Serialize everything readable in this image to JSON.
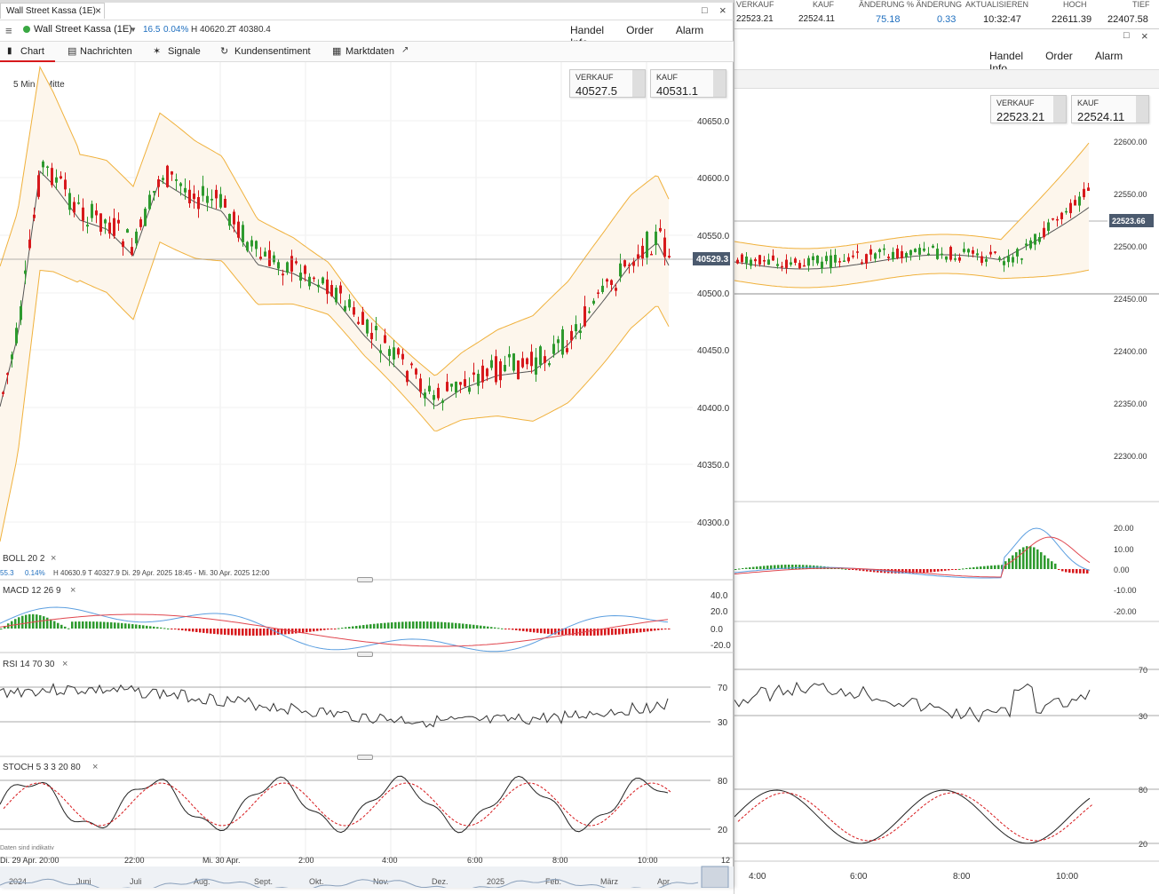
{
  "top_ticker": {
    "headers": [
      "VERKAUF",
      "KAUF",
      "ÄNDERUNG",
      "% ÄNDERUNG",
      "AKTUALISIEREN",
      "HOCH",
      "TIEF"
    ],
    "values": [
      "22523.21",
      "22524.11",
      "75.18",
      "0.33",
      "10:32:47",
      "22611.39",
      "22407.58"
    ]
  },
  "left_window": {
    "tab_title": "Wall Street Kassa (1E)",
    "instrument": "Wall Street Kassa (1E)",
    "change": "16.5",
    "change_pct": "0.04%",
    "high": "H 40620.2",
    "low": "T 40380.4",
    "menu": [
      "Handel",
      "Order",
      "Alarm",
      "Info"
    ],
    "tabs": [
      "Chart",
      "Nachrichten",
      "Signale",
      "Kundensentiment",
      "Marktdaten"
    ],
    "interval": "5 Min",
    "price_mode": "Mitte",
    "sell_label": "VERKAUF",
    "sell_value": "40527.5",
    "buy_label": "KAUF",
    "buy_value": "40531.1",
    "current_price_tag": "40529.3",
    "y_axis": [
      "40650.0",
      "40600.0",
      "40550.0",
      "40500.0",
      "40450.0",
      "40400.0",
      "40350.0",
      "40300.0"
    ],
    "boll_label": "BOLL  20  2",
    "boll_info_a": "55.3",
    "boll_info_b": "0.14%",
    "boll_info_c": "H 40630.9   T 40327.9   Di. 29 Apr. 2025 18:45 - Mi. 30 Apr. 2025 12:00",
    "macd_label": "MACD  12  26  9",
    "macd_axis": [
      "40.0",
      "20.0",
      "0.0",
      "-20.0"
    ],
    "rsi_label": "RSI  14  70  30",
    "rsi_axis": [
      "70",
      "30"
    ],
    "stoch_label": "STOCH  5  3  3  20  80",
    "stoch_axis": [
      "80",
      "20"
    ],
    "disclaimer": "Daten sind indikativ",
    "x_axis": [
      "Di. 29 Apr.  20:00",
      "22:00",
      "Mi. 30 Apr.",
      "2:00",
      "4:00",
      "6:00",
      "8:00",
      "10:00",
      "12"
    ],
    "nav_axis": [
      "2024",
      "Juni",
      "Juli",
      "Aug.",
      "Sept.",
      "Okt.",
      "Nov.",
      "Dez.",
      "2025",
      "Feb.",
      "März",
      "Apr."
    ]
  },
  "right_window": {
    "menu": [
      "Handel",
      "Order",
      "Alarm",
      "Info"
    ],
    "sell_label": "VERKAUF",
    "sell_value": "22523.21",
    "buy_label": "KAUF",
    "buy_value": "22524.11",
    "current_price_tag": "22523.66",
    "y_axis": [
      "22600.00",
      "22550.00",
      "22500.00",
      "22450.00",
      "22400.00",
      "22350.00",
      "22300.00"
    ],
    "macd_axis": [
      "20.00",
      "10.00",
      "0.00",
      "-10.00",
      "-20.00"
    ],
    "rsi_axis": [
      "70",
      "30"
    ],
    "stoch_axis": [
      "80",
      "20"
    ],
    "x_axis": [
      "4:00",
      "6:00",
      "8:00",
      "10:00"
    ]
  },
  "colors": {
    "up": "#2e9a2e",
    "down": "#d7191c",
    "band": "#f0b13c",
    "band_fill": "#fdf6ec",
    "accent": "#1f6fbf",
    "macd_line": "#5c9fe0",
    "signal_line": "#e0464e"
  }
}
